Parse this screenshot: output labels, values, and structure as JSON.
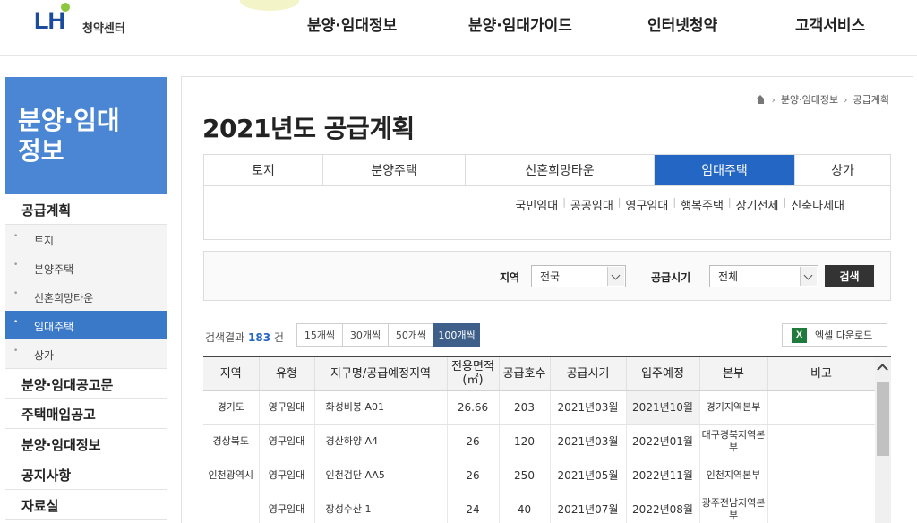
{
  "header": {
    "logo_mark": "LH",
    "logo_text": "청약센터",
    "nav": [
      "분양·임대정보",
      "분양·임대가이드",
      "인터넷청약",
      "고객서비스"
    ]
  },
  "sidebar": {
    "title_line1": "분양·임대",
    "title_line2": "정보",
    "section": "공급계획",
    "sub_items": [
      "토지",
      "분양주택",
      "신혼희망타운",
      "임대주택",
      "상가"
    ],
    "active_sub": "임대주택",
    "other_items": [
      "분양·임대공고문",
      "주택매입공고",
      "분양·임대정보",
      "공지사항",
      "자료실"
    ]
  },
  "breadcrumb": [
    "분양·임대정보",
    "공급계획"
  ],
  "page_title": "2021년도 공급계획",
  "tabs": [
    "토지",
    "분양주택",
    "신혼희망타운",
    "임대주택",
    "상가"
  ],
  "active_tab": "임대주택",
  "subtabs": [
    "국민임대",
    "공공임대",
    "영구임대",
    "행복주택",
    "장기전세",
    "신축다세대"
  ],
  "search": {
    "region_label": "지역",
    "region_value": "전국",
    "period_label": "공급시기",
    "period_value": "전체",
    "button": "검색"
  },
  "results": {
    "prefix": "검색결과",
    "count": "183",
    "suffix": "건",
    "per_page": [
      "15개씩",
      "30개씩",
      "50개씩",
      "100개씩"
    ],
    "active_per_page": "100개씩",
    "excel_label": "엑셀 다운로드"
  },
  "table": {
    "headers": [
      "지역",
      "유형",
      "지구명/공급예정지역",
      "전용면적\n(㎡)",
      "공급호수",
      "공급시기",
      "입주예정",
      "본부",
      "비고"
    ],
    "rows": [
      [
        "경기도",
        "영구임대",
        "화성비봉 A01",
        "26.66",
        "203",
        "2021년03월",
        "2021년10월",
        "경기지역본부",
        ""
      ],
      [
        "경상북도",
        "영구임대",
        "경산하양 A4",
        "26",
        "120",
        "2021년03월",
        "2022년01월",
        "대구경북지역본부",
        ""
      ],
      [
        "인천광역시",
        "영구임대",
        "인천검단 AA5",
        "26",
        "250",
        "2021년05월",
        "2022년11월",
        "인천지역본부",
        ""
      ],
      [
        "",
        "영구임대",
        "장성수산 1",
        "24",
        "40",
        "2021년07월",
        "2022년08월",
        "광주전남지역본부",
        ""
      ]
    ]
  },
  "colors": {
    "brand_blue": "#2466c3",
    "sidebar_blue": "#4a86d4",
    "excel_green": "#1e7b3c"
  }
}
